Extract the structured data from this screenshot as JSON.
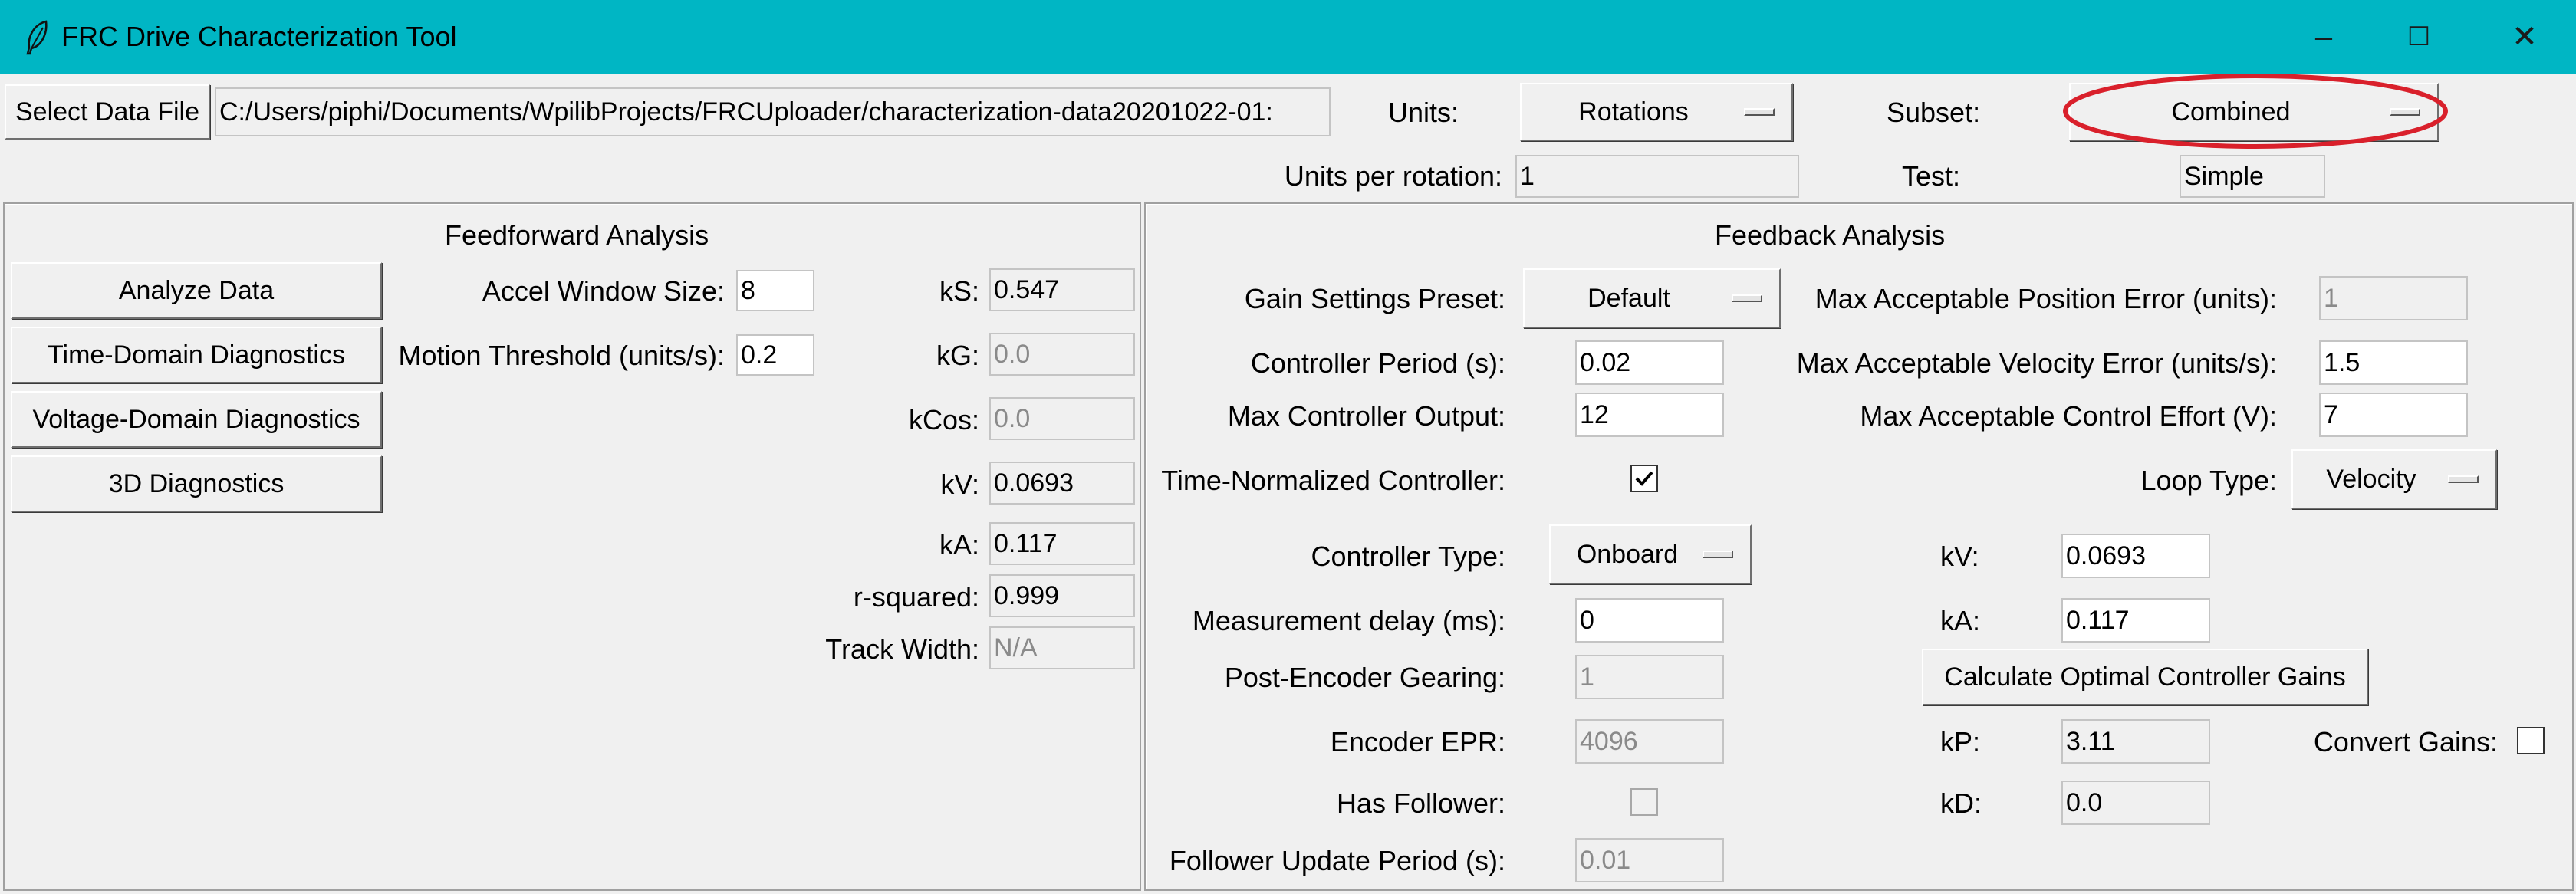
{
  "window": {
    "title": "FRC Drive Characterization Tool",
    "icon": "feather-icon",
    "controls": {
      "minimize": "–",
      "maximize": "☐",
      "close": "✕"
    }
  },
  "top_bar": {
    "select_data_file_label": "Select Data File",
    "file_path": "C:/Users/piphi/Documents/WpilibProjects/FRCUploader/characterization-data20201022-01:",
    "units_label": "Units:",
    "units_value": "Rotations",
    "subset_label": "Subset:",
    "subset_value": "Combined",
    "units_per_rotation_label": "Units per rotation:",
    "units_per_rotation_value": "1",
    "test_label": "Test:",
    "test_value": "Simple",
    "highlight_color": "#d9202b"
  },
  "feedforward": {
    "title": "Feedforward Analysis",
    "buttons": {
      "analyze": "Analyze Data",
      "time_domain": "Time-Domain Diagnostics",
      "voltage_domain": "Voltage-Domain Diagnostics",
      "diag_3d": "3D Diagnostics"
    },
    "accel_window_label": "Accel Window Size:",
    "accel_window_value": "8",
    "motion_threshold_label": "Motion Threshold (units/s):",
    "motion_threshold_value": "0.2",
    "ks_label": "kS:",
    "ks_value": "0.547",
    "kg_label": "kG:",
    "kg_value": "0.0",
    "kcos_label": "kCos:",
    "kcos_value": "0.0",
    "kv_label": "kV:",
    "kv_value": "0.0693",
    "ka_label": "kA:",
    "ka_value": "0.117",
    "rsquared_label": "r-squared:",
    "rsquared_value": "0.999",
    "track_width_label": "Track Width:",
    "track_width_value": "N/A"
  },
  "feedback": {
    "title": "Feedback Analysis",
    "gain_preset_label": "Gain Settings Preset:",
    "gain_preset_value": "Default",
    "controller_period_label": "Controller Period (s):",
    "controller_period_value": "0.02",
    "max_output_label": "Max Controller Output:",
    "max_output_value": "12",
    "time_normalized_label": "Time-Normalized Controller:",
    "time_normalized_checked": true,
    "controller_type_label": "Controller Type:",
    "controller_type_value": "Onboard",
    "measurement_delay_label": "Measurement delay (ms):",
    "measurement_delay_value": "0",
    "post_encoder_label": "Post-Encoder Gearing:",
    "post_encoder_value": "1",
    "encoder_epr_label": "Encoder EPR:",
    "encoder_epr_value": "4096",
    "has_follower_label": "Has Follower:",
    "has_follower_checked": false,
    "follower_period_label": "Follower Update Period (s):",
    "follower_period_value": "0.01",
    "max_pos_err_label": "Max Acceptable Position Error (units):",
    "max_pos_err_value": "1",
    "max_vel_err_label": "Max Acceptable Velocity Error (units/s):",
    "max_vel_err_value": "1.5",
    "max_effort_label": "Max Acceptable Control Effort (V):",
    "max_effort_value": "7",
    "loop_type_label": "Loop Type:",
    "loop_type_value": "Velocity",
    "kv_label": "kV:",
    "kv_value": "0.0693",
    "ka_label": "kA:",
    "ka_value": "0.117",
    "calc_button": "Calculate Optimal Controller Gains",
    "kp_label": "kP:",
    "kp_value": "3.11",
    "kd_label": "kD:",
    "kd_value": "0.0",
    "convert_gains_label": "Convert Gains:",
    "convert_gains_checked": false
  }
}
